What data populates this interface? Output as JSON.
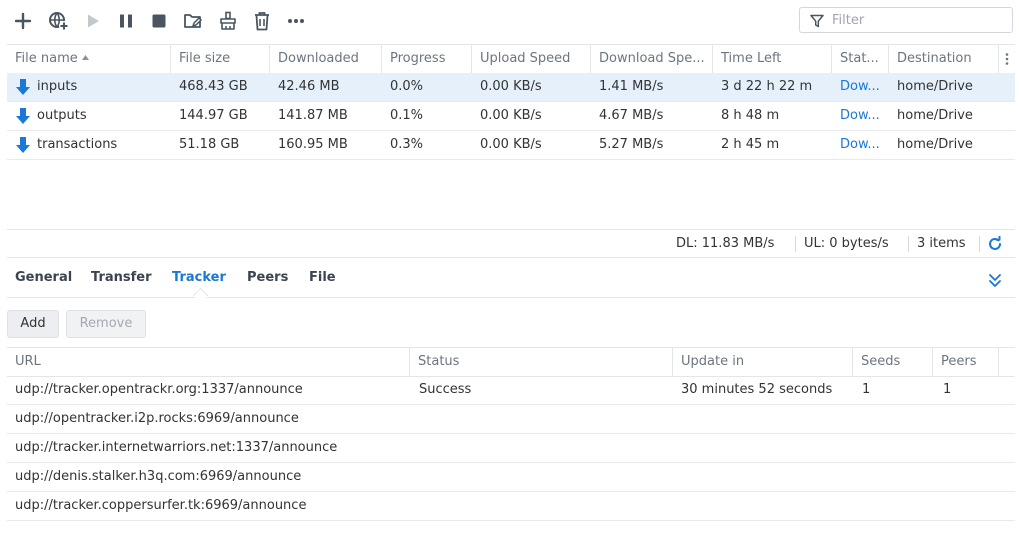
{
  "toolbar": {
    "icons": [
      "plus-icon",
      "add-url-icon",
      "play-icon",
      "pause-icon",
      "stop-icon",
      "open-folder-icon",
      "clean-icon",
      "trash-icon",
      "more-icon"
    ],
    "filter_placeholder": "Filter"
  },
  "downloads": {
    "columns": [
      "File name",
      "File size",
      "Downloaded",
      "Progress",
      "Upload Speed",
      "Download Spe...",
      "Time Left",
      "Stat...",
      "Destination"
    ],
    "sort_column": "File name",
    "rows": [
      {
        "name": "inputs",
        "size": "468.43 GB",
        "downloaded": "42.46 MB",
        "progress": "0.0%",
        "upload": "0.00 KB/s",
        "download": "1.41 MB/s",
        "time_left": "3 d 22 h 22 m",
        "status": "Dow...",
        "destination": "home/Drive",
        "selected": true
      },
      {
        "name": "outputs",
        "size": "144.97 GB",
        "downloaded": "141.87 MB",
        "progress": "0.1%",
        "upload": "0.00 KB/s",
        "download": "4.67 MB/s",
        "time_left": "8 h 48 m",
        "status": "Dow...",
        "destination": "home/Drive",
        "selected": false
      },
      {
        "name": "transactions",
        "size": "51.18 GB",
        "downloaded": "160.95 MB",
        "progress": "0.3%",
        "upload": "0.00 KB/s",
        "download": "5.27 MB/s",
        "time_left": "2 h 45 m",
        "status": "Dow...",
        "destination": "home/Drive",
        "selected": false
      }
    ]
  },
  "statusbar": {
    "dl": "DL: 11.83 MB/s",
    "ul": "UL: 0 bytes/s",
    "items": "3 items"
  },
  "tabs": [
    {
      "label": "General",
      "active": false
    },
    {
      "label": "Transfer",
      "active": false
    },
    {
      "label": "Tracker",
      "active": true
    },
    {
      "label": "Peers",
      "active": false
    },
    {
      "label": "File",
      "active": false
    }
  ],
  "tracker": {
    "add_label": "Add",
    "remove_label": "Remove",
    "columns": [
      "URL",
      "Status",
      "Update in",
      "Seeds",
      "Peers"
    ],
    "rows": [
      {
        "url": "udp://tracker.opentrackr.org:1337/announce",
        "status": "Success",
        "update_in": "30 minutes 52 seconds",
        "seeds": "1",
        "peers": "1"
      },
      {
        "url": "udp://opentracker.i2p.rocks:6969/announce",
        "status": "",
        "update_in": "",
        "seeds": "",
        "peers": ""
      },
      {
        "url": "udp://tracker.internetwarriors.net:1337/announce",
        "status": "",
        "update_in": "",
        "seeds": "",
        "peers": ""
      },
      {
        "url": "udp://denis.stalker.h3q.com:6969/announce",
        "status": "",
        "update_in": "",
        "seeds": "",
        "peers": ""
      },
      {
        "url": "udp://tracker.coppersurfer.tk:6969/announce",
        "status": "",
        "update_in": "",
        "seeds": "",
        "peers": ""
      }
    ]
  },
  "colors": {
    "accent": "#1a78d6",
    "selected_row": "#e6f0fb",
    "icon": "#4a5560"
  }
}
